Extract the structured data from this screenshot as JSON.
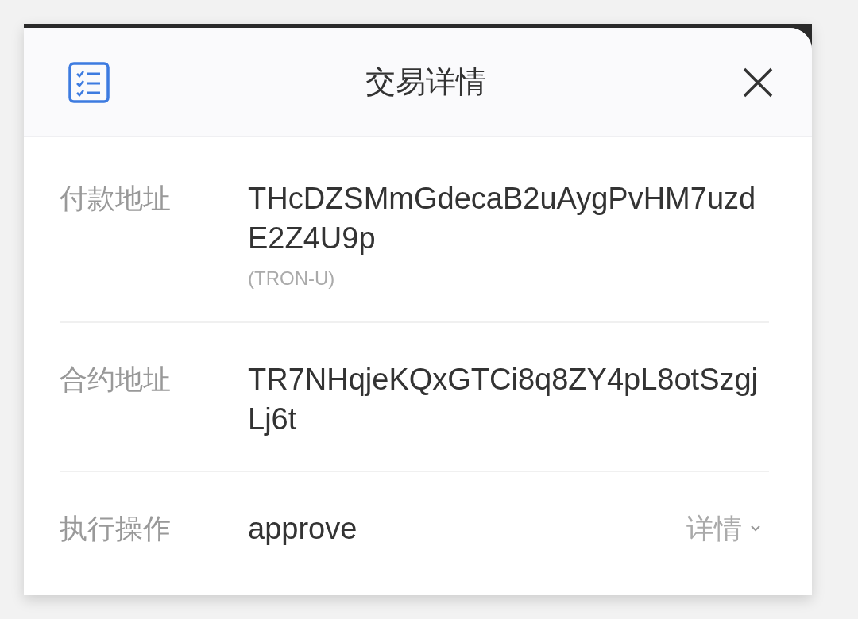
{
  "header": {
    "title": "交易详情"
  },
  "rows": [
    {
      "kind": "address",
      "label": "付款地址",
      "value": "THcDZSMmGdecaB2uAygPvHM7uzdE2Z4U9p",
      "note": "(TRON-U)"
    },
    {
      "kind": "address",
      "label": "合约地址",
      "value": "TR7NHqjeKQxGTCi8q8ZY4pL8otSzgjLj6t"
    },
    {
      "kind": "action",
      "label": "执行操作",
      "value": "approve",
      "link": "详情"
    }
  ]
}
